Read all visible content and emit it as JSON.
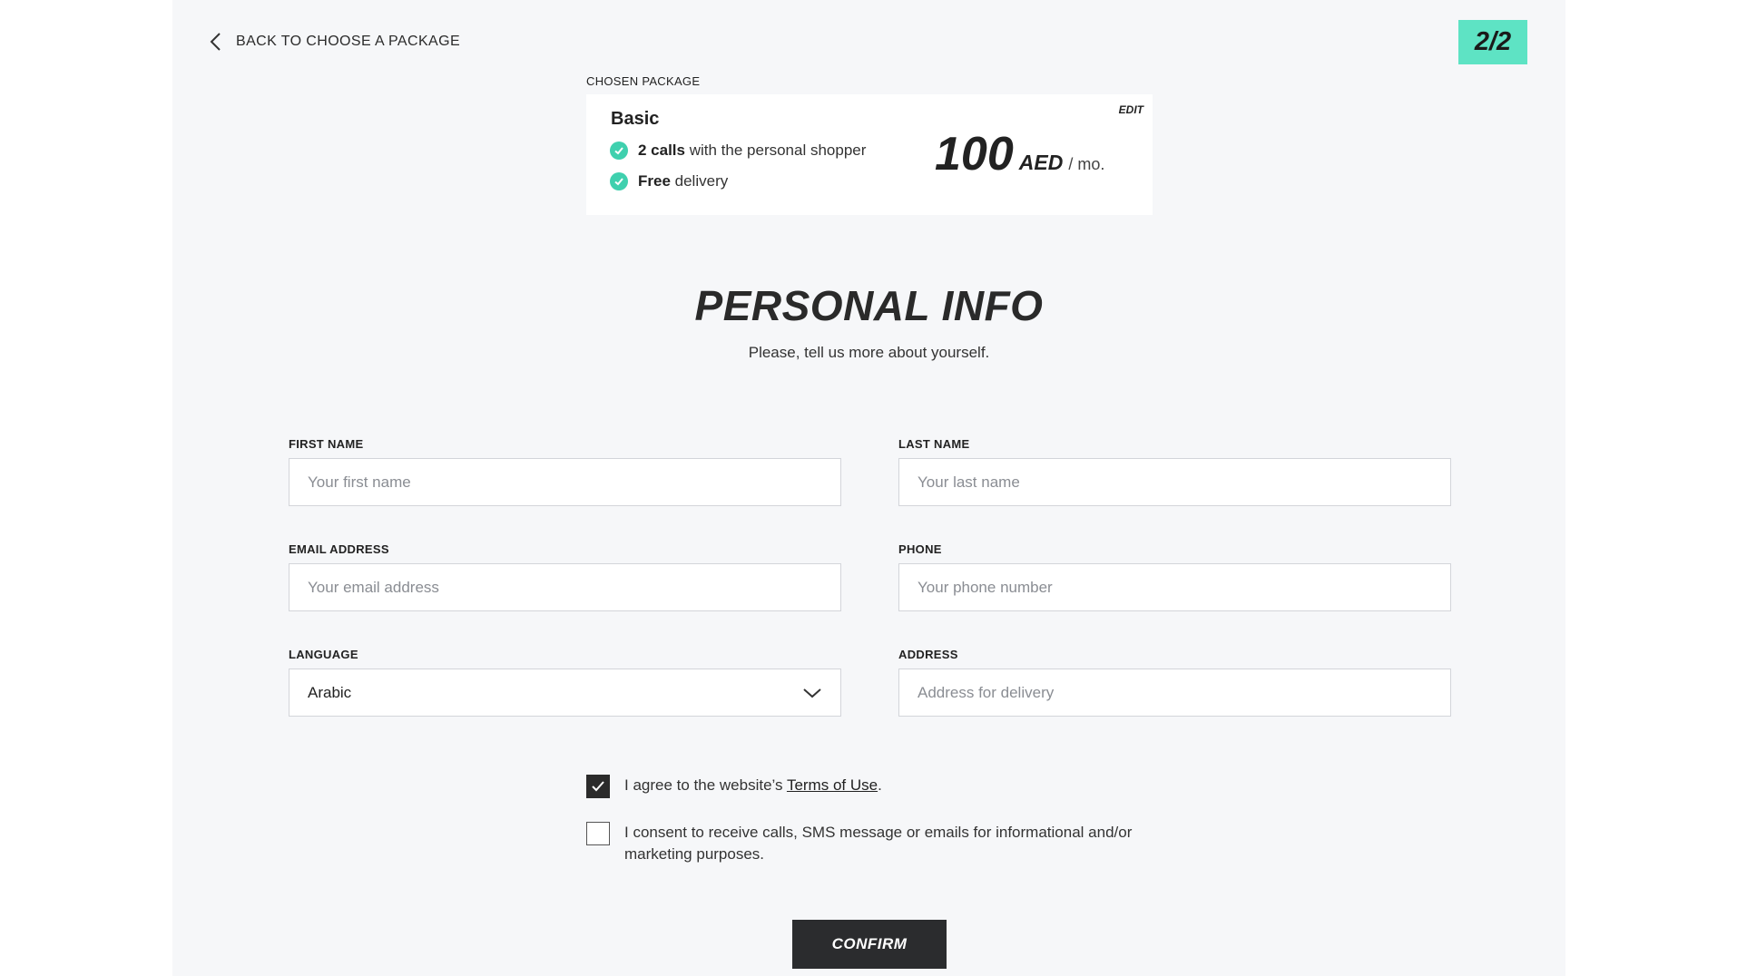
{
  "back_link": {
    "label": "BACK TO CHOOSE A PACKAGE",
    "icon": "chevron-left-icon"
  },
  "step": {
    "label": "2/2"
  },
  "package": {
    "section_label": "CHOSEN PACKAGE",
    "edit_label": "EDIT",
    "name": "Basic",
    "features": [
      {
        "bold": "2 calls",
        "rest": " with the personal shopper",
        "icon": "check-circle-icon"
      },
      {
        "bold": "Free",
        "rest": " delivery",
        "icon": "check-circle-icon"
      }
    ],
    "price": {
      "amount": "100",
      "currency": "AED",
      "period": "/ mo."
    }
  },
  "heading": {
    "title": "PERSONAL INFO",
    "subtitle": "Please, tell us more about yourself."
  },
  "form": {
    "first_name": {
      "label": "FIRST NAME",
      "placeholder": "Your first name",
      "value": ""
    },
    "last_name": {
      "label": "LAST NAME",
      "placeholder": "Your last name",
      "value": ""
    },
    "email": {
      "label": "EMAIL ADDRESS",
      "placeholder": "Your email address",
      "value": ""
    },
    "phone": {
      "label": "PHONE",
      "placeholder": "Your phone number",
      "value": ""
    },
    "language": {
      "label": "LANGUAGE",
      "value": "Arabic",
      "icon": "chevron-down-icon"
    },
    "address": {
      "label": "ADDRESS",
      "placeholder": "Address for delivery",
      "value": ""
    }
  },
  "consents": {
    "terms": {
      "checked": true,
      "prefix": "I agree to the website’s ",
      "link": "Terms of Use",
      "suffix": "."
    },
    "marketing": {
      "checked": false,
      "text": "I consent to receive calls, SMS message or emails for informational and/or marketing purposes."
    }
  },
  "confirm_label": "CONFIRM",
  "colors": {
    "accent": "#5ee3c4",
    "check": "#3fd0ae",
    "page_bg": "#f6f7f9",
    "button_bg": "#2b2c2e"
  }
}
